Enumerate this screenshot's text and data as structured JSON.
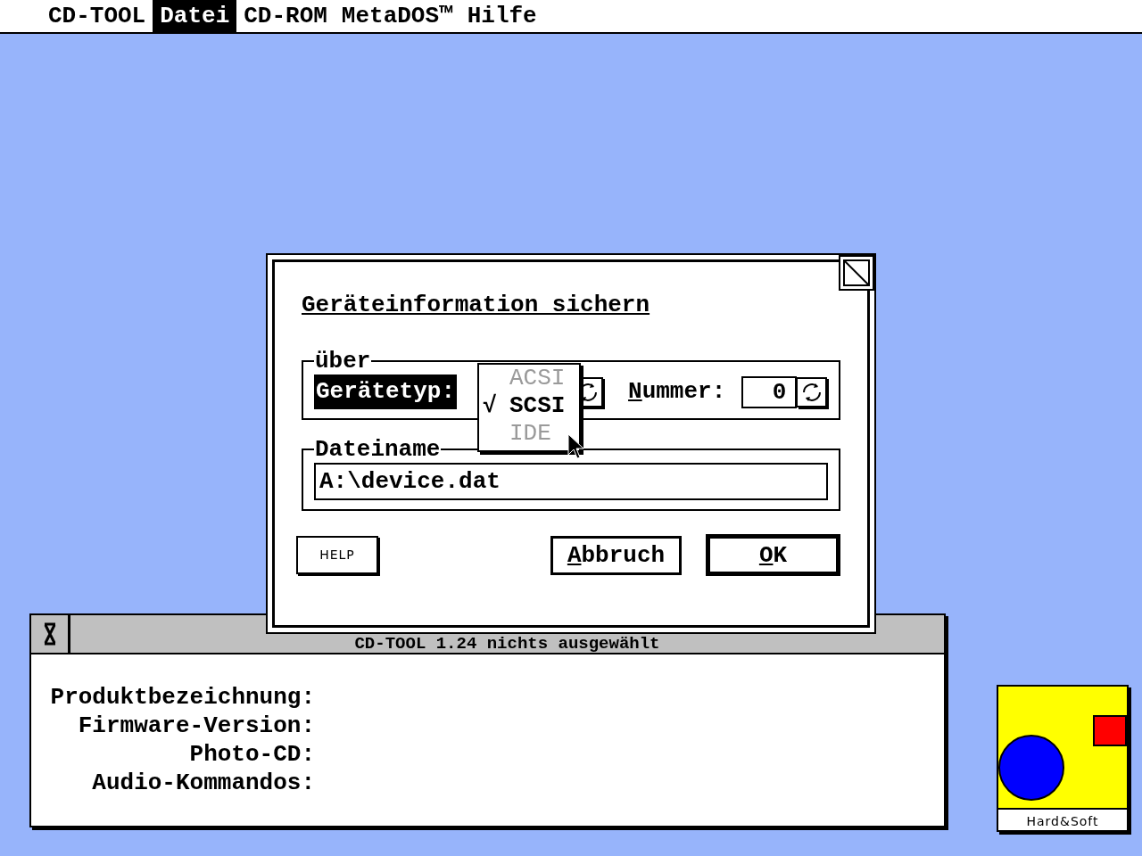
{
  "menu_bar": [
    {
      "label": "CD-TOOL",
      "selected": false
    },
    {
      "label": "Datei",
      "selected": true
    },
    {
      "label": "CD-ROM",
      "selected": false
    },
    {
      "label": "MetaDOS™",
      "selected": false
    },
    {
      "label": "Hilfe",
      "selected": false
    }
  ],
  "dialog": {
    "title": "Geräteinformation sichern",
    "device_group": {
      "legend": "über",
      "device_type": {
        "label": "Gerätetyp:",
        "selected": true,
        "check_symbol": "√",
        "options": [
          {
            "label": "ACSI",
            "checked": false,
            "disabled": true
          },
          {
            "label": "SCSI",
            "checked": true,
            "disabled": false
          },
          {
            "label": "IDE",
            "checked": false,
            "disabled": true
          }
        ]
      },
      "number": {
        "label": "Nummer:",
        "mnemonic": true,
        "value": "0"
      }
    },
    "file_group": {
      "legend": "Dateiname",
      "value": "A:\\device.dat"
    },
    "buttons": [
      {
        "label": "HELP",
        "kind": "help"
      },
      {
        "label": "Abbruch",
        "kind": "action",
        "mnemonic": true,
        "default": false
      },
      {
        "label": "OK",
        "kind": "action",
        "mnemonic": true,
        "default": true
      }
    ]
  },
  "window": {
    "title": "CD-TOOL 1.24  nichts ausgewählt",
    "fields": [
      {
        "label": "Produktbezeichnung:"
      },
      {
        "label": "Firmware-Version:"
      },
      {
        "label": "Photo-CD:"
      },
      {
        "label": "Audio-Kommandos:"
      }
    ]
  },
  "desktop_icons": [
    {
      "label": "Hard&Soft"
    }
  ]
}
